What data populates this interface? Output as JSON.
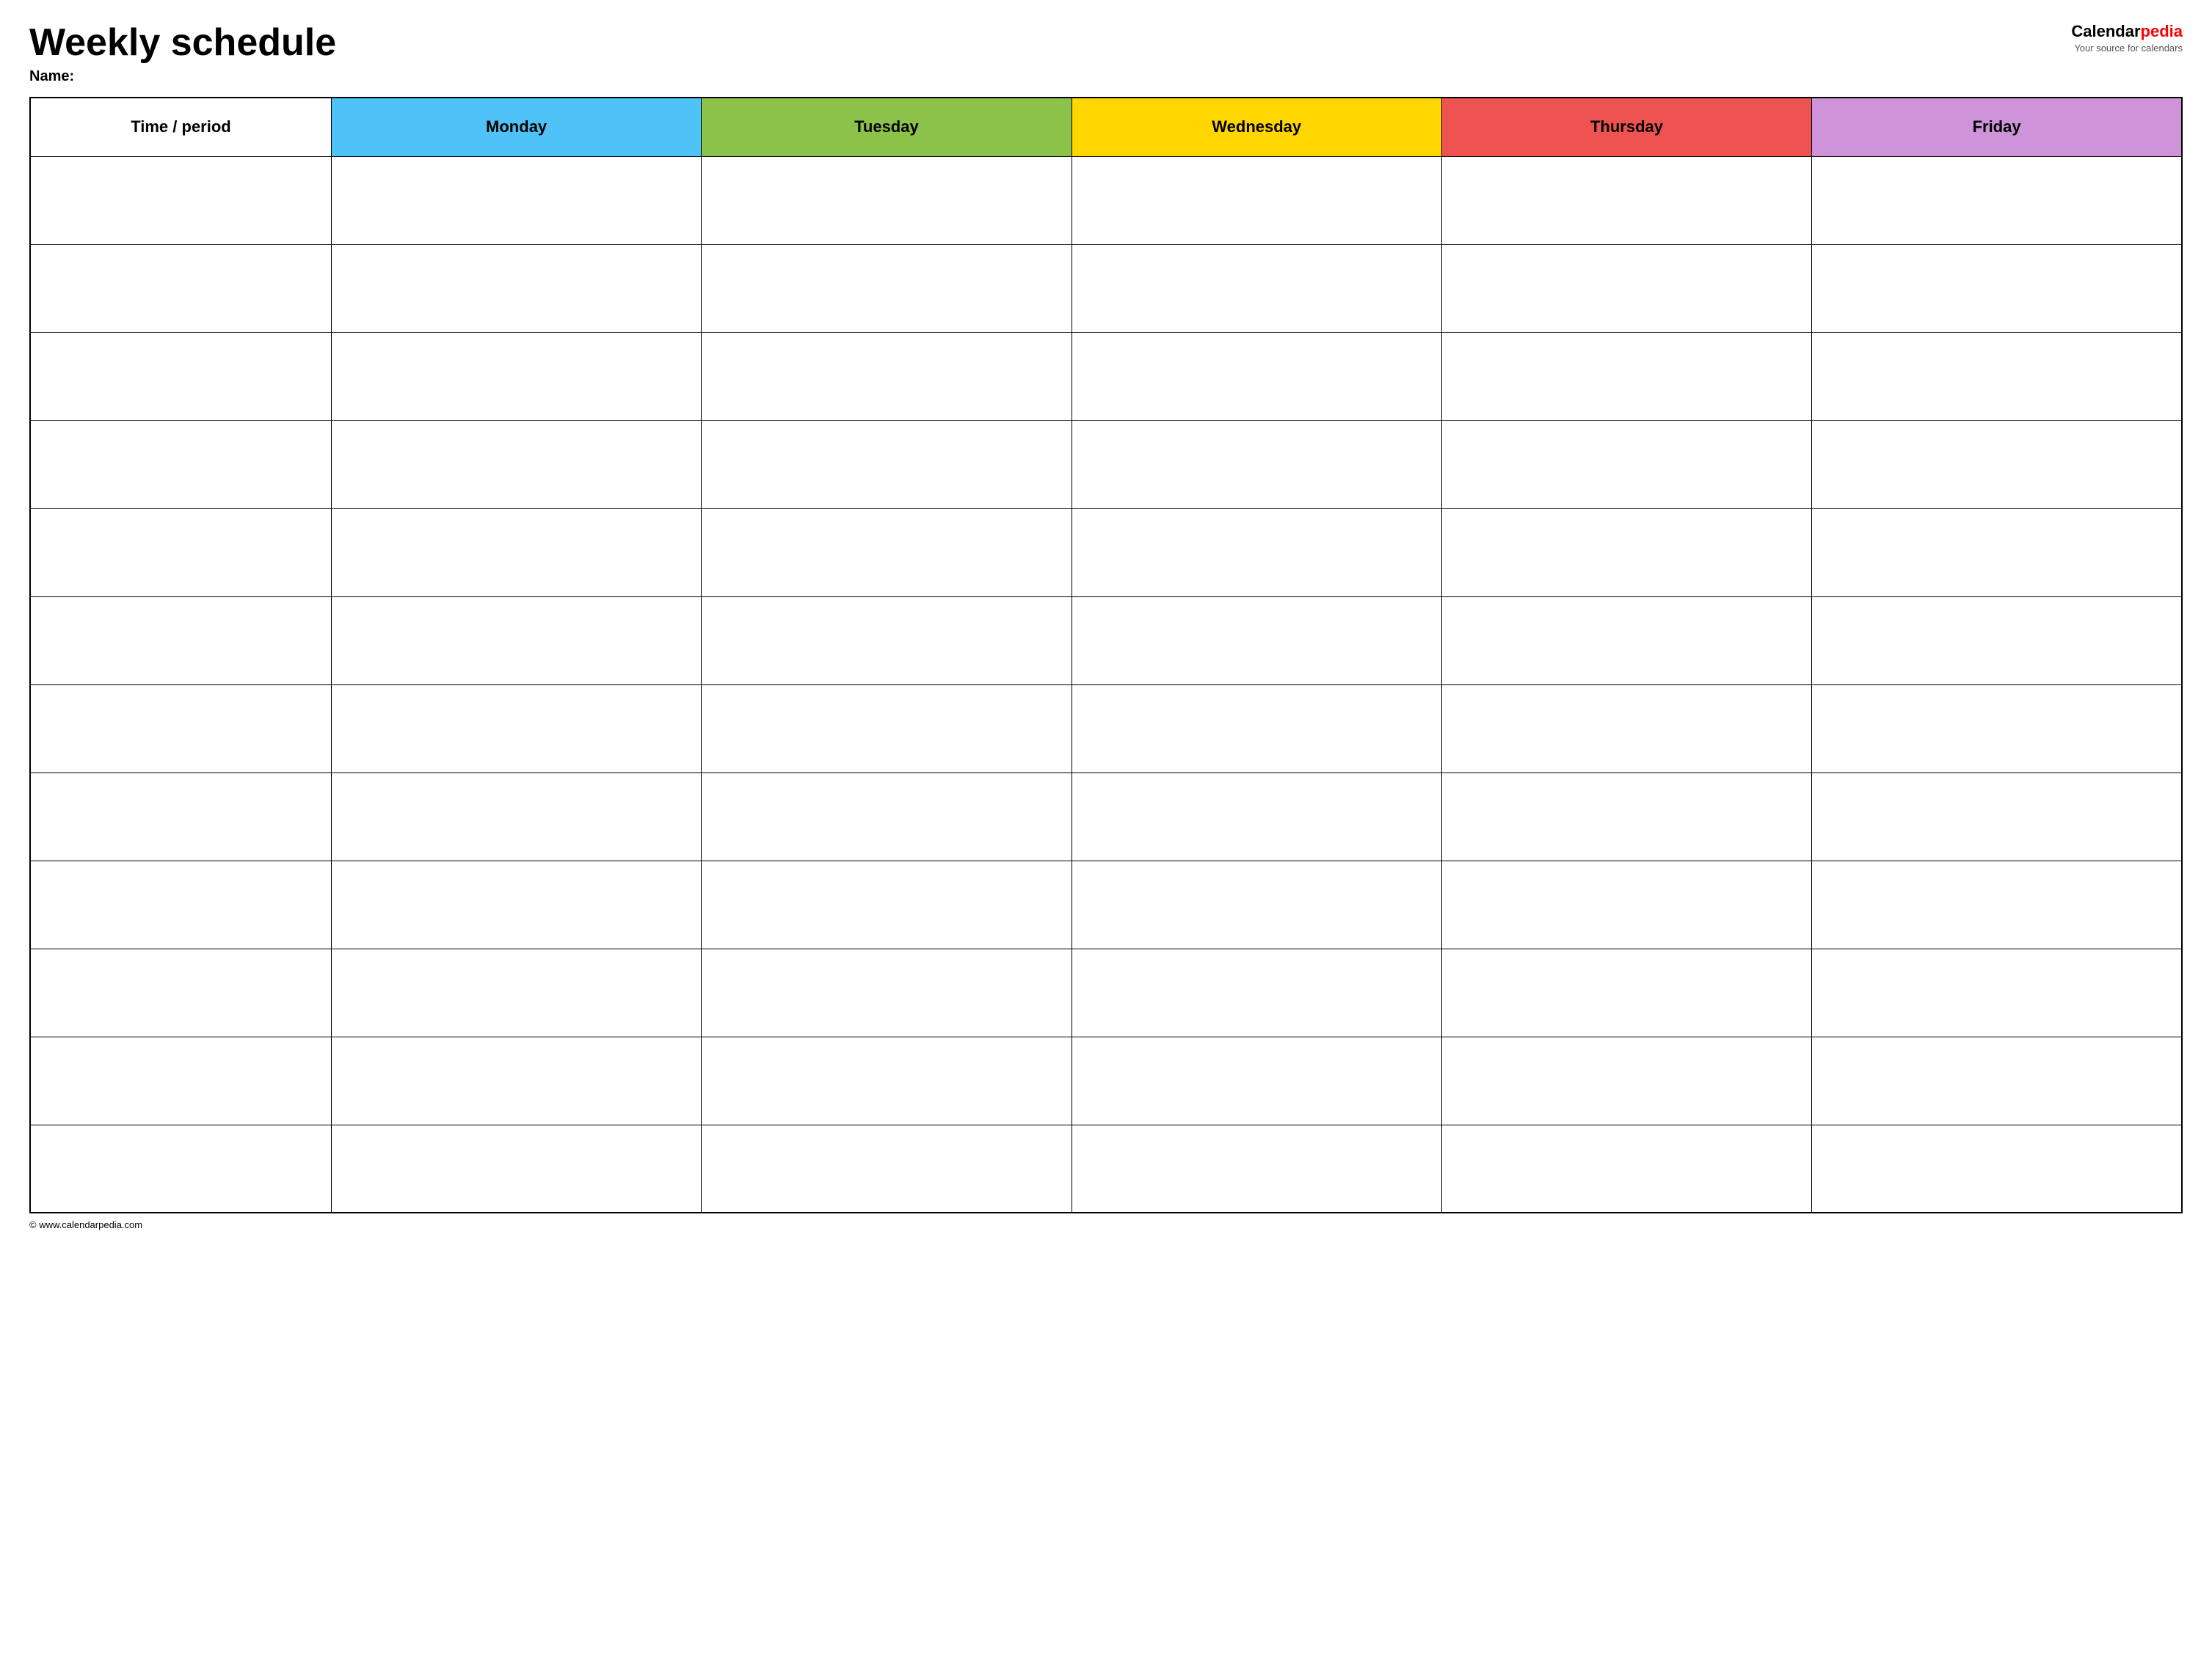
{
  "header": {
    "title": "Weekly schedule",
    "name_label": "Name:",
    "logo_calendar": "Calendar",
    "logo_pedia": "pedia",
    "logo_tagline": "Your source for calendars"
  },
  "table": {
    "columns": [
      {
        "id": "time",
        "label": "Time / period",
        "color": "#ffffff"
      },
      {
        "id": "monday",
        "label": "Monday",
        "color": "#4fc3f7"
      },
      {
        "id": "tuesday",
        "label": "Tuesday",
        "color": "#8bc34a"
      },
      {
        "id": "wednesday",
        "label": "Wednesday",
        "color": "#ffd600"
      },
      {
        "id": "thursday",
        "label": "Thursday",
        "color": "#ef5350"
      },
      {
        "id": "friday",
        "label": "Friday",
        "color": "#ce93d8"
      }
    ],
    "row_count": 12
  },
  "footer": {
    "url": "© www.calendarpedia.com"
  }
}
